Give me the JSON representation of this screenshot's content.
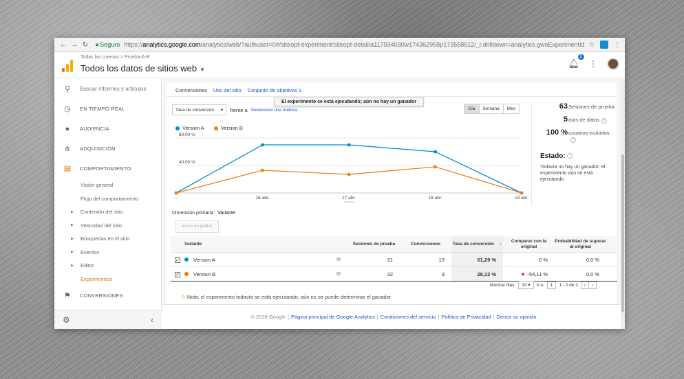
{
  "browser": {
    "secure_label": "Seguro",
    "url_scheme": "https://",
    "url_host": "analytics.google.com",
    "url_path": "/analytics/web/?authuser=0#/siteopt-experiment/siteopt-detail/a117594030w174362958p173558512/_r.drilldown=analytics.gwoExperimentId:zC..."
  },
  "header": {
    "breadcrumb": "Todas las cuentas  >  Prueba-A-B",
    "title": "Todos los datos de sitios web",
    "notification_count": "2"
  },
  "sidebar": {
    "search_placeholder": "Buscar informes y artículos",
    "items": [
      {
        "label": "EN TIEMPO REAL",
        "icon": "clock-icon"
      },
      {
        "label": "AUDIENCIA",
        "icon": "person-icon"
      },
      {
        "label": "ADQUISICIÓN",
        "icon": "acquisition-icon"
      },
      {
        "label": "COMPORTAMIENTO",
        "icon": "behavior-icon"
      }
    ],
    "behavior_sub": [
      {
        "label": "Visión general"
      },
      {
        "label": "Flujo del comportamiento"
      },
      {
        "label": "Contenido del sitio"
      },
      {
        "label": "Velocidad del sitio"
      },
      {
        "label": "Búsquedas en el sitio"
      },
      {
        "label": "Eventos"
      },
      {
        "label": "Editor"
      },
      {
        "label": "Experimentos"
      }
    ],
    "conversions": "CONVERSIONES"
  },
  "subtabs": [
    "Conversiones",
    "Uso del sitio",
    "Conjunto de objetivos 1"
  ],
  "tooltip": "El experimento se está ejecutando; aún no hay un ganador",
  "controls": {
    "metric": "Tasa de conversión",
    "vs": "frente a",
    "select_metric": "Seleccione una métrica",
    "periods": [
      "Día",
      "Semana",
      "Mes"
    ],
    "active_period": "Día"
  },
  "chart_data": {
    "type": "line",
    "x": [
      "...",
      "16 abr.",
      "17 abr.",
      "18 abr.",
      "19 abr."
    ],
    "y_ticks": [
      "80,00 %",
      "40,00 %"
    ],
    "ylim": [
      0,
      80
    ],
    "series": [
      {
        "name": "Version A",
        "color": "#058dc7",
        "values": [
          0,
          70,
          70,
          60,
          0
        ]
      },
      {
        "name": "Version B",
        "color": "#ed7e17",
        "values": [
          0,
          33,
          27,
          38,
          0
        ]
      }
    ]
  },
  "stats": {
    "sessions": {
      "value": "63",
      "label": "Sesiones de prueba"
    },
    "days": {
      "value": "5",
      "label": "días de datos"
    },
    "users": {
      "value": "100 %",
      "label": "usuarios incluidos"
    }
  },
  "estado": {
    "title": "Estado:",
    "text": "Todavía no hay un ganador: el experimento aún se está ejecutando"
  },
  "dimension": {
    "label": "Dimensión primaria:",
    "value": "Variante"
  },
  "add_chart": "Incluir en gráfico",
  "table": {
    "headers": {
      "variant": "Variante",
      "sessions": "Sesiones de prueba",
      "conversions": "Conversiones",
      "rate": "Tasa de conversión",
      "compare": "Comparar con la original",
      "probability": "Probabilidad de superar al original"
    },
    "rows": [
      {
        "name": "Version A",
        "color": "#058dc7",
        "sessions": "31",
        "conversions": "19",
        "rate": "61,29 %",
        "compare": "0 %",
        "probability": "0,0 %"
      },
      {
        "name": "Version B",
        "color": "#ed7e17",
        "sessions": "32",
        "conversions": "9",
        "rate": "28,12 %",
        "compare": "-54,11 %",
        "probability": "0,0 %"
      }
    ]
  },
  "pager": {
    "show_rows_label": "Mostrar filas:",
    "rows": "10",
    "goto_label": "Ir a:",
    "goto_value": "1",
    "range": "1 - 2 de 2"
  },
  "note": "Nota: el experimento todavía se está ejecutando; aún no se puede determinar el ganador",
  "footer": {
    "copyright": "© 2018 Google",
    "links": [
      "Página principal de Google Analytics",
      "Condiciones del servicio",
      "Política de Privacidad",
      "Denos su opinión"
    ]
  }
}
